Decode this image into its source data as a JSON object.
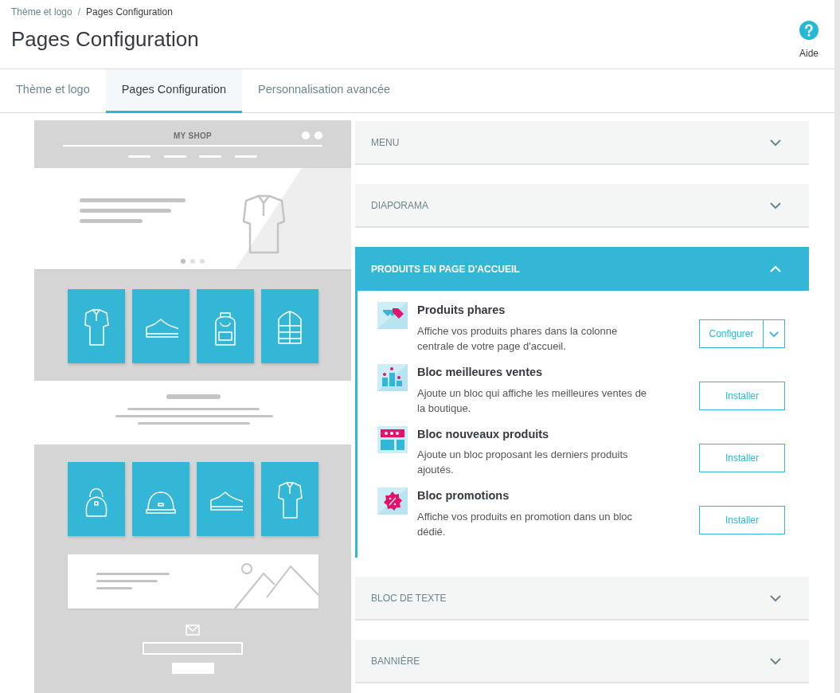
{
  "breadcrumb": [
    {
      "label": "Thème et logo"
    },
    {
      "label": "Pages Configuration"
    }
  ],
  "breadcrumb_separator": "/",
  "page_title": "Pages Configuration",
  "help": {
    "label": "Aide"
  },
  "tabs": [
    {
      "label": "Thème et logo",
      "selected": false
    },
    {
      "label": "Pages Configuration",
      "selected": true
    },
    {
      "label": "Personnalisation avancée",
      "selected": false
    }
  ],
  "mockup": {
    "shop_name": "MY SHOP"
  },
  "sections": [
    {
      "title": "MENU",
      "expanded": false
    },
    {
      "title": "DIAPORAMA",
      "expanded": false
    },
    {
      "title": "PRODUITS EN PAGE D'ACCUEIL",
      "expanded": true,
      "modules": [
        {
          "name": "Produits phares",
          "description": "Affiche vos produits phares dans la colonne centrale de votre page d'accueil.",
          "action": {
            "kind": "split",
            "label": "Configurer"
          }
        },
        {
          "name": "Bloc meilleures ventes",
          "description": "Ajoute un bloc qui affiche les meilleures ventes de la boutique.",
          "action": {
            "kind": "plain",
            "label": "Installer"
          }
        },
        {
          "name": "Bloc nouveaux produits",
          "description": "Ajoute un bloc proposant les derniers produits ajoutés.",
          "action": {
            "kind": "plain",
            "label": "Installer"
          }
        },
        {
          "name": "Bloc promotions",
          "description": "Affiche vos produits en promotion dans un bloc dédié.",
          "action": {
            "kind": "plain",
            "label": "Installer"
          }
        }
      ]
    },
    {
      "title": "BLOC DE TEXTE",
      "expanded": false
    },
    {
      "title": "BANNIÈRE",
      "expanded": false
    }
  ]
}
